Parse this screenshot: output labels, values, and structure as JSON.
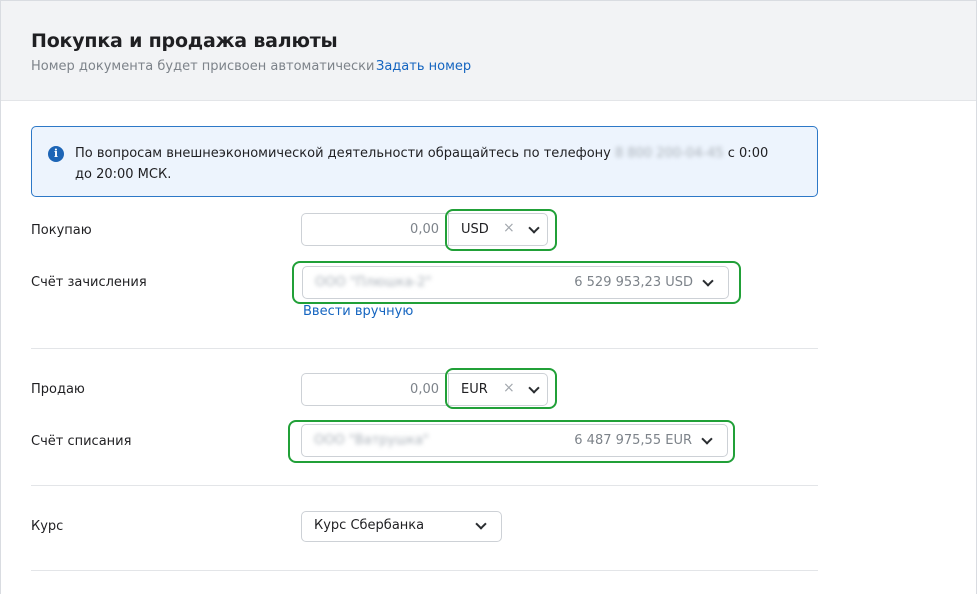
{
  "header": {
    "title": "Покупка и продажа валюты",
    "subtitle": "Номер документа будет присвоен автоматически",
    "set_number_link": "Задать номер"
  },
  "info": {
    "icon": "info-icon",
    "text_before_phone": "По вопросам внешнеэкономической деятельности обращайтесь по телефону ",
    "phone": "8 800 200-04-45",
    "text_after_phone": " с 0:00 до 20:00 МСК."
  },
  "buy": {
    "label": "Покупаю",
    "amount": "0,00",
    "currency": "USD",
    "clear_glyph": "×"
  },
  "credit_account": {
    "label": "Счёт зачисления",
    "name": "ООО \"Плюшка-2\"",
    "balance": "6 529 953,23 USD",
    "manual_link": "Ввести вручную"
  },
  "sell": {
    "label": "Продаю",
    "amount": "0,00",
    "currency": "EUR",
    "clear_glyph": "×"
  },
  "debit_account": {
    "label": "Счёт списания",
    "name": "ООО \"Ватрушка\"",
    "balance": "6 487 975,55 EUR"
  },
  "rate": {
    "label": "Курс",
    "value": "Курс Сбербанка"
  },
  "colors": {
    "highlight": "#21a038",
    "link": "#1565c0",
    "info_border": "#2d78c7",
    "info_bg": "#edf4fd"
  }
}
